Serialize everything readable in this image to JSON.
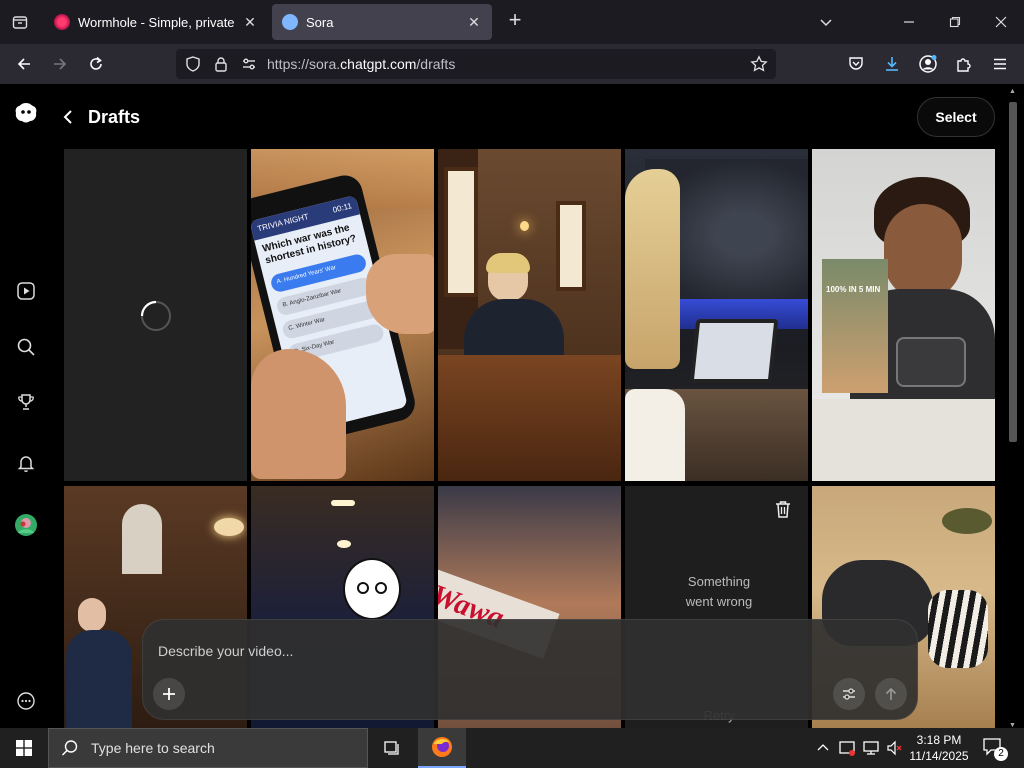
{
  "browser": {
    "tabs": [
      {
        "title": "Wormhole - Simple, private file",
        "active": false
      },
      {
        "title": "Sora",
        "active": true
      }
    ],
    "url_prefix": "https://sora.",
    "url_domain": "chatgpt.com",
    "url_path": "/drafts"
  },
  "header": {
    "title": "Drafts",
    "select_label": "Select"
  },
  "tiles": {
    "error_line1": "Something",
    "error_line2": "went wrong",
    "retry_label": "Retry",
    "phone_header": "TRIVIA NIGHT",
    "phone_timer": "00:11",
    "phone_question": "Which war was the shortest in history?",
    "phone_options": [
      "A. Hundred Years' War",
      "B. Anglo-Zanzibar War",
      "C. Winter War",
      "D. Six-Day War"
    ],
    "banner_text": "100% IN 5 MIN",
    "store_sign": "Wawa"
  },
  "prompt": {
    "placeholder": "Describe your video..."
  },
  "taskbar": {
    "search_placeholder": "Type here to search",
    "time": "3:18 PM",
    "date": "11/14/2025",
    "notifications": "2"
  },
  "colors": {
    "tab_strip": "#1c1b22",
    "nav_bar": "#2b2a33",
    "active_tab": "#42414d",
    "page_bg": "#000000",
    "taskbar": "#202020"
  }
}
